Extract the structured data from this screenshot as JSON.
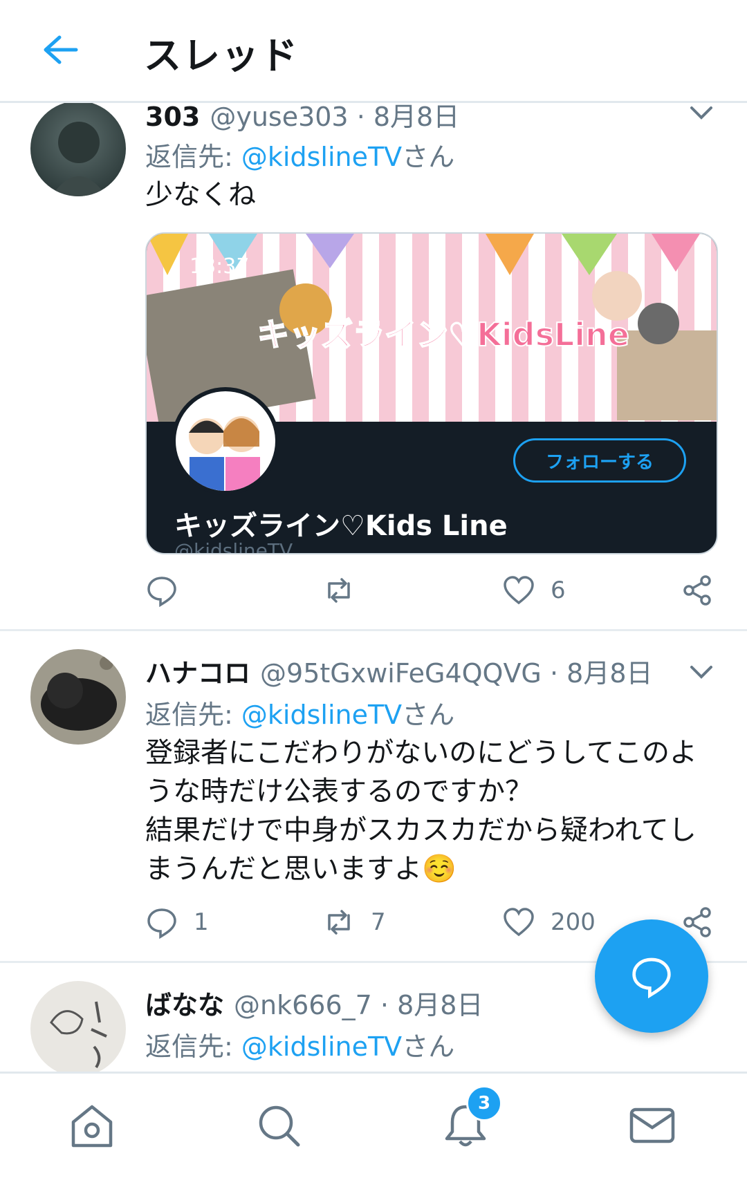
{
  "header": {
    "title": "スレッド"
  },
  "tweets": [
    {
      "name": "303",
      "handle": "@yuse303",
      "date": "8月8日",
      "reply_prefix": "返信先:",
      "reply_mention": "@kidslineTV",
      "reply_suffix": "さん",
      "text": "少なくね",
      "card": {
        "clock": "13:37",
        "banner_title": "キッズライン♡KidsLine",
        "follow_label": "フォローする",
        "name": "キッズライン♡Kids Line",
        "handle": "@kidslineTV"
      },
      "counts": {
        "reply": "",
        "retweet": "",
        "like": "6"
      }
    },
    {
      "name": "ハナコロ",
      "handle": "@95tGxwiFeG4QQVG",
      "date": "8月8日",
      "reply_prefix": "返信先:",
      "reply_mention": "@kidslineTV",
      "reply_suffix": "さん",
      "text": "登録者にこだわりがないのにどうしてこのような時だけ公表するのですか？\n結果だけで中身がスカスカだから疑われてしまうんだと思いますよ☺️",
      "counts": {
        "reply": "1",
        "retweet": "7",
        "like": "200"
      }
    },
    {
      "name": "ばなな",
      "handle": "@nk666_7",
      "date": "8月8日",
      "reply_prefix": "返信先:",
      "reply_mention": "@kidslineTV",
      "reply_suffix": "さん"
    }
  ],
  "tabbar": {
    "notification_count": "3"
  },
  "colors": {
    "accent": "#1da1f2",
    "text": "#14171a",
    "muted": "#657786"
  }
}
